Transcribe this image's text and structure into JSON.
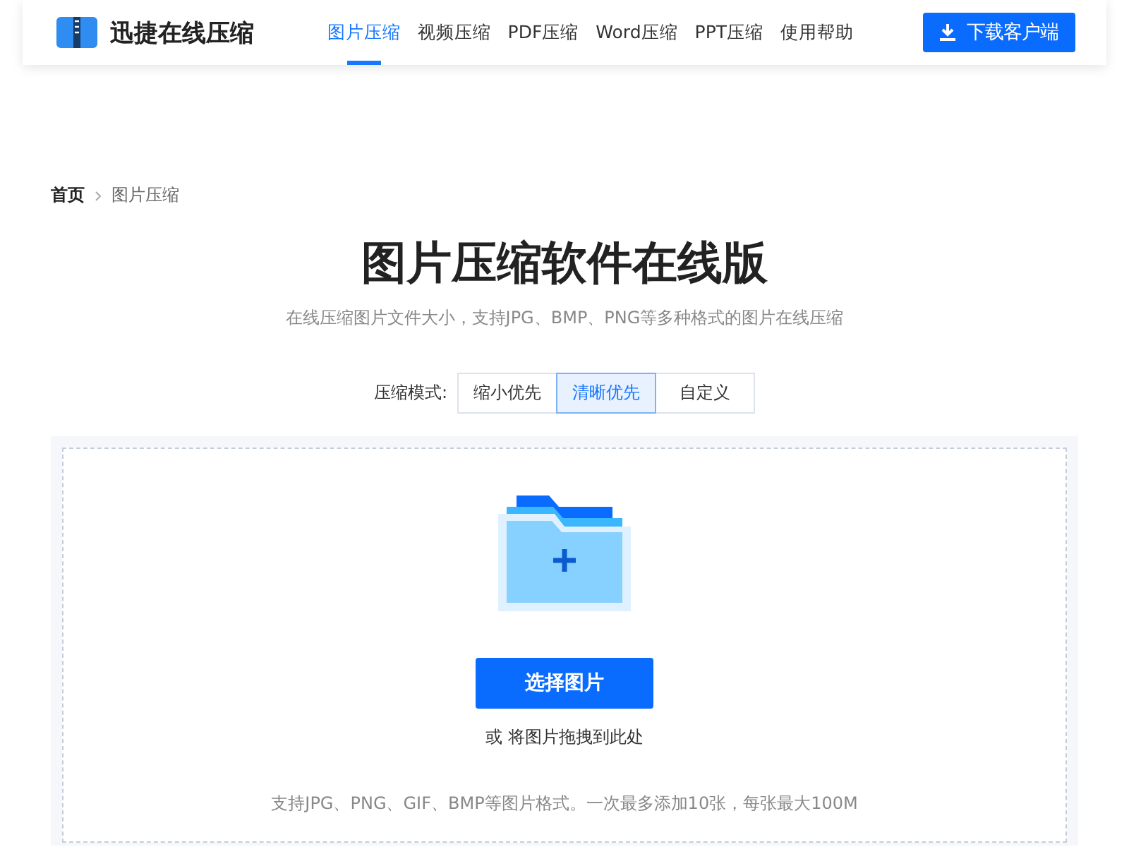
{
  "header": {
    "brand": "迅捷在线压缩",
    "nav": [
      {
        "label": "图片压缩",
        "selected": true
      },
      {
        "label": "视频压缩",
        "selected": false
      },
      {
        "label": "PDF压缩",
        "selected": false
      },
      {
        "label": "Word压缩",
        "selected": false
      },
      {
        "label": "PPT压缩",
        "selected": false
      },
      {
        "label": "使用帮助",
        "selected": false
      }
    ],
    "download_button": "下载客户端"
  },
  "breadcrumb": [
    "首页",
    "图片压缩"
  ],
  "title": "图片压缩软件在线版",
  "subtitle": "在线压缩图片文件大小，支持JPG、BMP、PNG等多种格式的图片在线压缩",
  "mode": {
    "label": "压缩模式:",
    "options": [
      {
        "label": "缩小优先",
        "selected": false
      },
      {
        "label": "清晰优先",
        "selected": true
      },
      {
        "label": "自定义",
        "selected": false
      }
    ]
  },
  "upload": {
    "button": "选择图片",
    "drop_hint": "或 将图片拖拽到此处",
    "note": "支持JPG、PNG、GIF、BMP等图片格式。一次最多添加10张，每张最大100M"
  }
}
